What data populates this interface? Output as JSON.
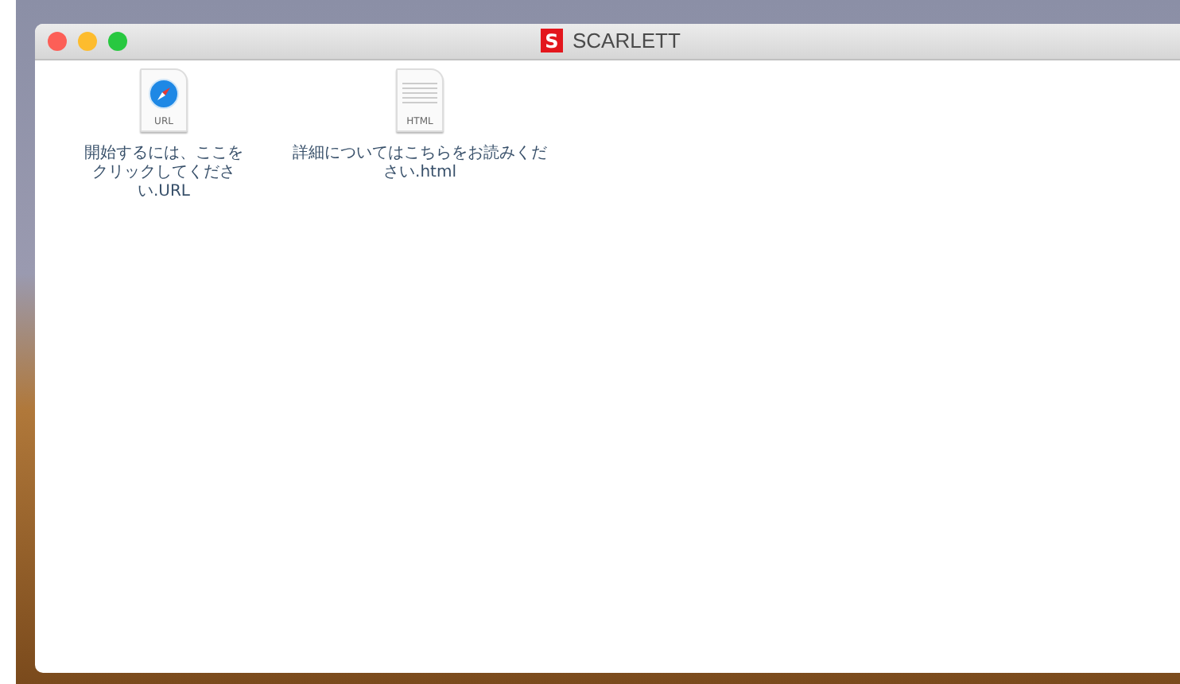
{
  "window": {
    "title": "SCARLETT",
    "logo": "S"
  },
  "files": [
    {
      "kind": "url",
      "icon_label": "URL",
      "name": "開始するには、ここをクリックしてください.URL"
    },
    {
      "kind": "html",
      "icon_label": "HTML",
      "name": "詳細についてはこちらをお読みください.html"
    }
  ]
}
